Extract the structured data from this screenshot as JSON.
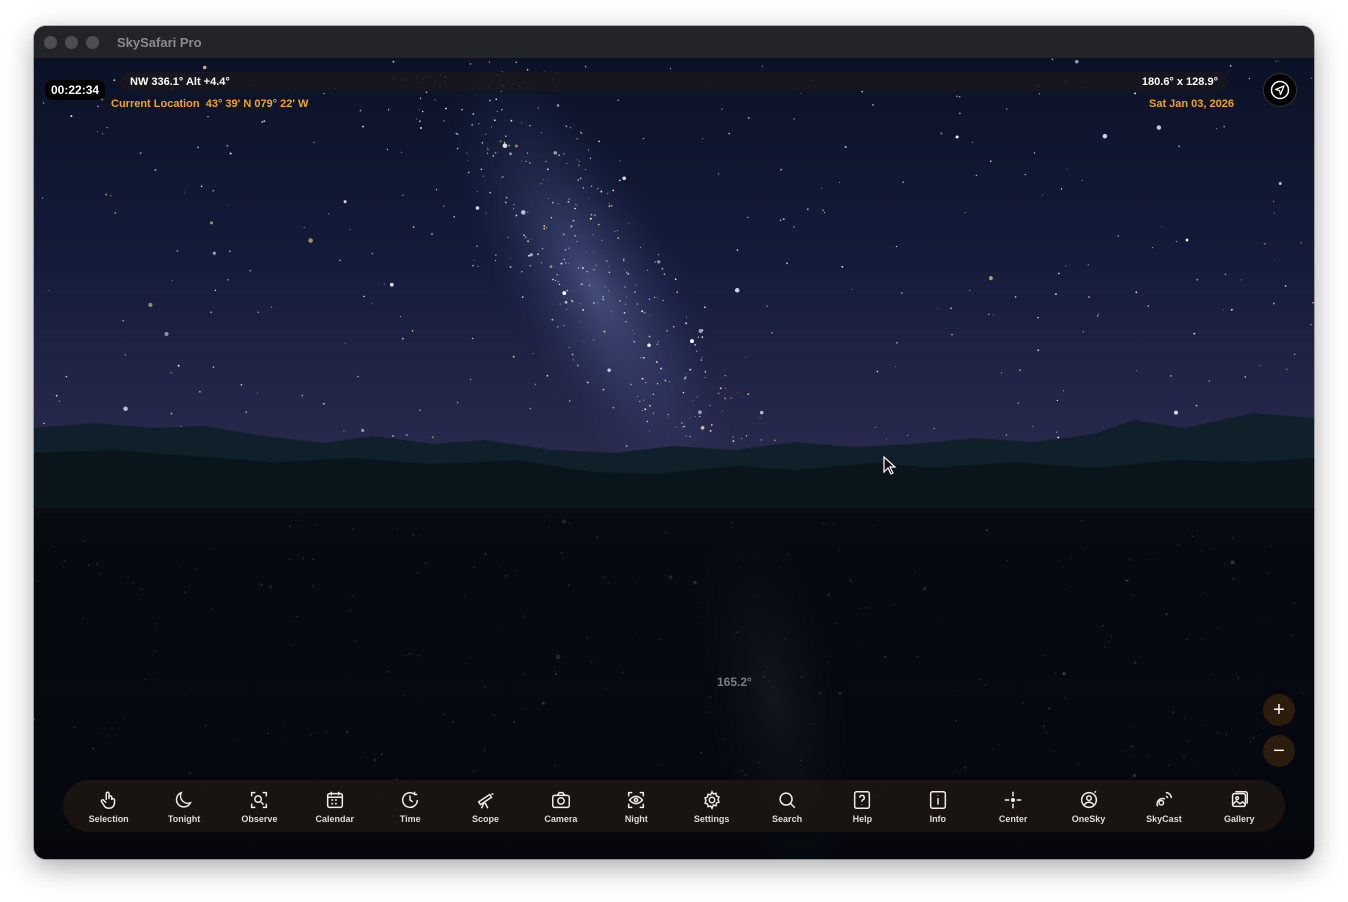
{
  "window": {
    "title": "SkySafari Pro"
  },
  "hud": {
    "time": "00:22:34",
    "direction": "NW 336.1° Alt +4.4°",
    "field_of_view": "180.6° x 128.9°",
    "location": "Current Location  43° 39' N 079° 22' W",
    "date": "Sat Jan 03, 2026",
    "horizon_label": "165.2°"
  },
  "toolbar": {
    "items": [
      {
        "label": "Selection",
        "icon": "hand-pointer-icon"
      },
      {
        "label": "Tonight",
        "icon": "moon-icon"
      },
      {
        "label": "Observe",
        "icon": "observe-icon"
      },
      {
        "label": "Calendar",
        "icon": "calendar-icon"
      },
      {
        "label": "Time",
        "icon": "clock-icon"
      },
      {
        "label": "Scope",
        "icon": "telescope-icon"
      },
      {
        "label": "Camera",
        "icon": "camera-icon"
      },
      {
        "label": "Night",
        "icon": "eye-icon"
      },
      {
        "label": "Settings",
        "icon": "gear-icon"
      },
      {
        "label": "Search",
        "icon": "search-icon"
      },
      {
        "label": "Help",
        "icon": "question-icon"
      },
      {
        "label": "Info",
        "icon": "info-icon"
      },
      {
        "label": "Center",
        "icon": "crosshair-icon"
      },
      {
        "label": "OneSky",
        "icon": "onesky-icon"
      },
      {
        "label": "SkyCast",
        "icon": "skycast-icon"
      },
      {
        "label": "Gallery",
        "icon": "gallery-icon"
      }
    ]
  },
  "controls": {
    "zoom_in": "+",
    "zoom_out": "−",
    "compass": "navigation-arrow-icon"
  },
  "colors": {
    "accent": "#f0a320",
    "toolbar_bg": "#1c1612",
    "sky_top": "#0b1226",
    "ground": "#05070c"
  }
}
